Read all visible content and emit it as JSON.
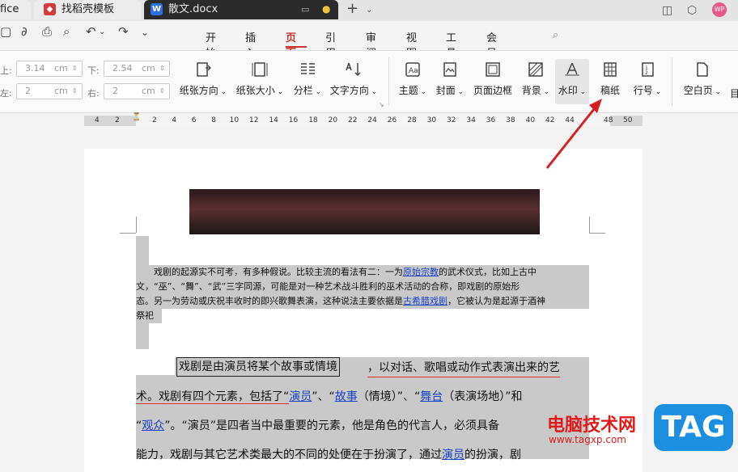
{
  "tabs": [
    {
      "label": "fice"
    },
    {
      "label": "找稻壳模板"
    },
    {
      "label": "散文.docx"
    }
  ],
  "menu": {
    "items": [
      "开始",
      "插入",
      "页面",
      "引用",
      "审阅",
      "视图",
      "工具",
      "会员专享"
    ],
    "active": "页面"
  },
  "margins": {
    "top_label": "上:",
    "top_value": "3.14",
    "bottom_label": "下:",
    "bottom_value": "2.54",
    "left_label": "左:",
    "left_value": "2",
    "right_label": "右:",
    "right_value": "2",
    "unit": "cm"
  },
  "ribbon": {
    "paper_direction": "纸张方向",
    "paper_size": "纸张大小",
    "columns": "分栏",
    "text_direction": "文字方向",
    "theme": "主题",
    "cover": "封面",
    "page_border": "页面边框",
    "background": "背景",
    "watermark": "水印",
    "manuscript": "稿纸",
    "line_number": "行号",
    "blank_page": "空白页"
  },
  "ruler": {
    "left": [
      "4",
      "2"
    ],
    "marks": [
      "2",
      "4",
      "6",
      "8",
      "10",
      "12",
      "14",
      "16",
      "18",
      "20",
      "22",
      "24",
      "26",
      "28",
      "30",
      "32",
      "34",
      "36",
      "38",
      "40",
      "42",
      "44"
    ],
    "right": [
      "48",
      "50"
    ]
  },
  "doc": {
    "para1": [
      {
        "t": "　　戏剧的起源实不可考，有多种假说。比较主流的看法有二：一为"
      },
      {
        "t": "原始宗教",
        "link": true
      },
      {
        "t": "的武术仪式，比如上古中"
      }
    ],
    "para1_line2": "文，“巫”、“舞”、“武”三字同源，可能是对一种艺术战斗胜利的巫术活动的合称，即戏剧的原始形",
    "para1_line3a": "态。另一为劳动或庆祝丰收时的即兴歌舞表演，这种说法主要依据是",
    "para1_line3_link": "古希腊戏剧",
    "para1_line3b": "，它被认为是起源于酒神",
    "para1_line4": "祭祀",
    "para2_boxed": "戏剧是由演员将某个故事或情境",
    "para2_line1_rest": "，以对话、歌唱或动作式表演出来的艺",
    "para2_line2a": "术。戏剧有四个元素，包括了“",
    "para2_l2_link1": "演员",
    "para2_l2_mid1": "”、“",
    "para2_l2_link2": "故事",
    "para2_l2_mid2": "（情境）”、“",
    "para2_l2_link3": "舞台",
    "para2_l2_end": "（表演场地）”和",
    "para2_line3_link": "观众",
    "para2_line3_rest": "”。“演员”是四者当中最重要的元素，他是角色的代言人，必须具备",
    "para2_line4": "能力，戏剧与其它艺术类最大的不同的处便在于扮演了，通过",
    "para2_line4_link": "演员",
    "para2_line4_end": "的扮演，剧"
  },
  "watermark_site": {
    "title": "电脑技术网",
    "url": "www.tagxp.com",
    "tag": "TAG"
  }
}
